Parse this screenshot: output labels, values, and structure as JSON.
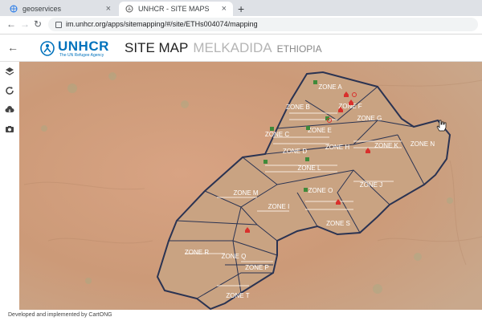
{
  "browser": {
    "tabs": [
      {
        "label": "geoservices",
        "close": "×"
      },
      {
        "label": "UNHCR - SITE MAPS",
        "close": "×"
      }
    ],
    "new_tab": "+",
    "url": "im.unhcr.org/apps/sitemapping/#/site/ETHs004074/mapping"
  },
  "header": {
    "back": "←",
    "logo_name": "UNHCR",
    "logo_tagline": "The UN Refugee Agency",
    "title": "SITE MAP",
    "place": "MELKADIDA",
    "country": "ETHIOPIA"
  },
  "sidebar": {
    "buttons": [
      "layers-icon",
      "refresh-icon",
      "cloud-download-icon",
      "camera-icon"
    ]
  },
  "map": {
    "zones": [
      "ZONE A",
      "ZONE B",
      "ZONE C",
      "ZONE D",
      "ZONE E",
      "ZONE F",
      "ZONE G",
      "ZONE H",
      "ZONE I",
      "ZONE J",
      "ZONE K",
      "ZONE L",
      "ZONE M",
      "ZONE N",
      "ZONE O",
      "ZONE P",
      "ZONE Q",
      "ZONE R",
      "ZONE S",
      "ZONE T"
    ],
    "colors": {
      "boundary": "#2a3352",
      "ground": "#cc9a78",
      "marker_red": "#d9302c",
      "marker_green": "#3f8a3a"
    }
  },
  "footer": {
    "credit": "Developed and implemented by CartONG"
  }
}
